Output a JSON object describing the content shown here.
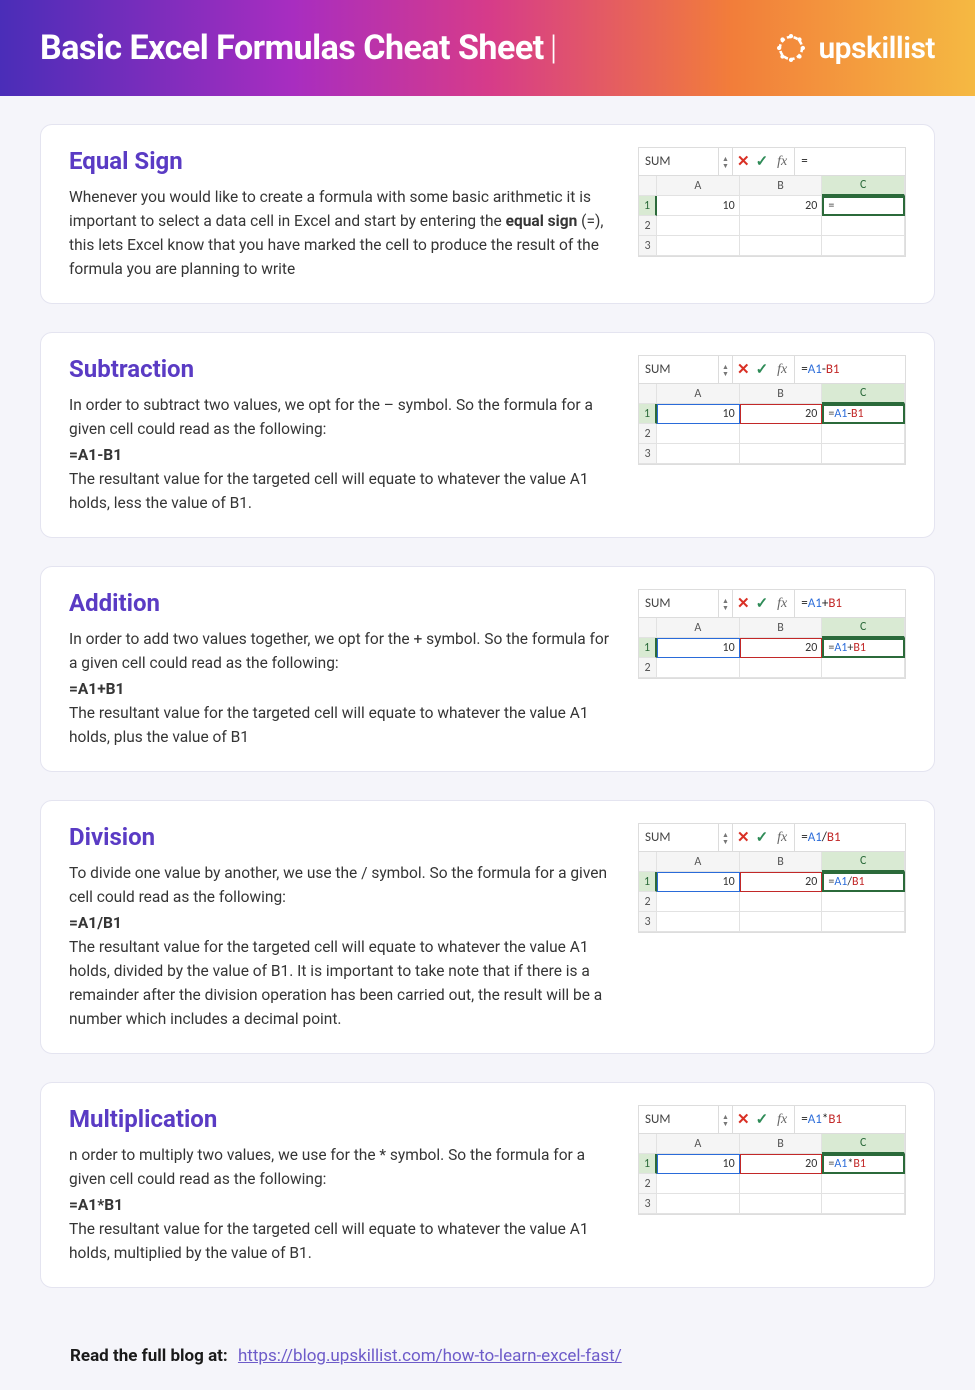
{
  "header": {
    "title": "Basic Excel Formulas Cheat Sheet",
    "separator": "|",
    "brand": "upskillist"
  },
  "sections": [
    {
      "title": "Equal Sign",
      "desc_pre": "Whenever you would like to create a formula with some basic arithmetic it is important to select a data cell in Excel and start by entering the ",
      "desc_bold": "equal sign",
      "desc_post": " (=), this lets Excel know that you have marked the cell to produce the result of the formula you are planning to write",
      "formula": "",
      "desc_after": "",
      "excel": {
        "name": "SUM",
        "fx": "=",
        "rows": [
          "1",
          "2",
          "3"
        ],
        "a1": "10",
        "b1": "20",
        "c1": "=",
        "ref_highlight": false
      }
    },
    {
      "title": "Subtraction",
      "desc_pre": "In order to subtract two values, we opt for the – symbol. So the formula for a given cell could read as the following:",
      "desc_bold": "",
      "desc_post": "",
      "formula": "=A1-B1",
      "desc_after": "The resultant value for the targeted cell will equate to whatever the value A1 holds, less the value of B1.",
      "excel": {
        "name": "SUM",
        "fx_plain": "=",
        "fx_a": "A1",
        "fx_op": "-",
        "fx_b": "B1",
        "rows": [
          "1",
          "2",
          "3"
        ],
        "a1": "10",
        "b1": "20",
        "c1_plain": "=",
        "c1_a": "A1",
        "c1_op": "-",
        "c1_b": "B1",
        "ref_highlight": true
      }
    },
    {
      "title": "Addition",
      "desc_pre": "In order to add two values together, we opt for the + symbol. So the formula for a given cell could read as the following:",
      "desc_bold": "",
      "desc_post": "",
      "formula": "=A1+B1",
      "desc_after": "The resultant value for the targeted cell will equate to whatever the value A1 holds, plus the value of B1",
      "excel": {
        "name": "SUM",
        "fx_plain": "=",
        "fx_a": "A1",
        "fx_op": "+",
        "fx_b": "B1",
        "rows": [
          "1",
          "2"
        ],
        "a1": "10",
        "b1": "20",
        "c1_plain": "=",
        "c1_a": "A1",
        "c1_op": "+",
        "c1_b": "B1",
        "ref_highlight": true
      }
    },
    {
      "title": "Division",
      "desc_pre": "To divide one value by another, we use the / symbol. So the formula for a given cell could read as the following:",
      "desc_bold": "",
      "desc_post": "",
      "formula": "=A1/B1",
      "desc_after": "The resultant value for the targeted cell will equate to whatever the value A1 holds, divided by the value of B1. It is important to take note that if there is a remainder after the division operation has been carried out, the result will be a number which includes a decimal point.",
      "excel": {
        "name": "SUM",
        "fx_plain": "=",
        "fx_a": "A1",
        "fx_op": "/",
        "fx_b": "B1",
        "rows": [
          "1",
          "2",
          "3"
        ],
        "a1": "10",
        "b1": "20",
        "c1_plain": "=",
        "c1_a": "A1",
        "c1_op": "/",
        "c1_b": "B1",
        "ref_highlight": true
      }
    },
    {
      "title": "Multiplication",
      "desc_pre": "n order to multiply two values, we use for the * symbol. So the formula for a given cell could read as the following:",
      "desc_bold": "",
      "desc_post": "",
      "formula": "=A1*B1",
      "desc_after": "The resultant value for the targeted cell will equate to whatever the value A1 holds, multiplied by the value of B1.",
      "excel": {
        "name": "SUM",
        "fx_plain": "=",
        "fx_a": "A1",
        "fx_op": "*",
        "fx_b": "B1",
        "rows": [
          "1",
          "2",
          "3"
        ],
        "a1": "10",
        "b1": "20",
        "c1_plain": "=",
        "c1_a": "A1",
        "c1_op": "*",
        "c1_b": "B1",
        "ref_highlight": true
      }
    }
  ],
  "cols": [
    "A",
    "B",
    "C"
  ],
  "footer": {
    "label": "Read the full blog at:",
    "link": "https://blog.upskillist.com/how-to-learn-excel-fast/"
  }
}
